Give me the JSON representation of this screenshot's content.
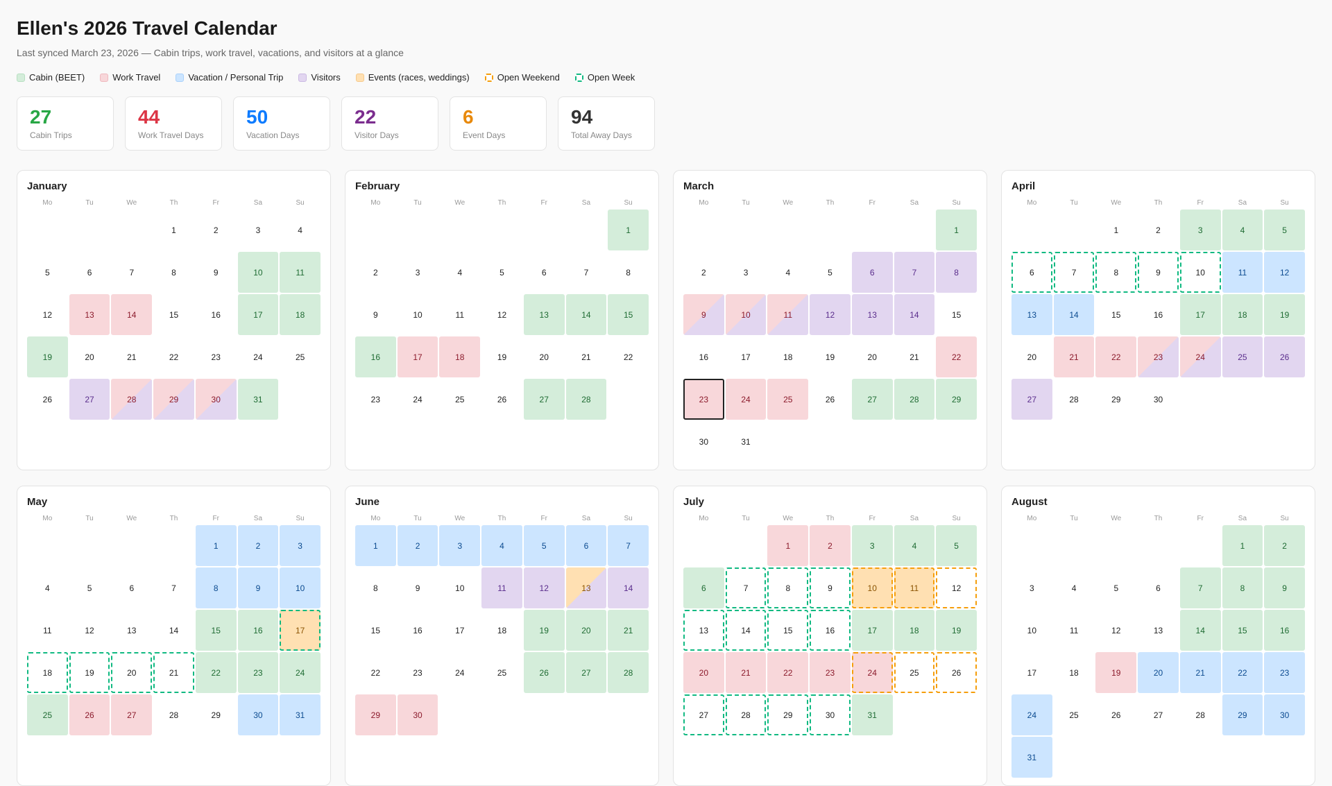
{
  "header": {
    "title": "Ellen's 2026 Travel Calendar",
    "subtitle": "Last synced March 23, 2026 — Cabin trips, work travel, vacations, and visitors at a glance"
  },
  "legend": [
    {
      "key": "cabin",
      "label": "Cabin (BEET)",
      "bg": "#d4edda",
      "border": "#b7dfc1"
    },
    {
      "key": "work",
      "label": "Work Travel",
      "bg": "#f8d7da",
      "border": "#efb8be"
    },
    {
      "key": "vacation",
      "label": "Vacation / Personal Trip",
      "bg": "#cce5ff",
      "border": "#a9d1fb"
    },
    {
      "key": "visitors",
      "label": "Visitors",
      "bg": "#e2d6f0",
      "border": "#cbb9e3"
    },
    {
      "key": "event",
      "label": "Events (races, weddings)",
      "bg": "#ffe0b2",
      "border": "#f6c98a"
    },
    {
      "key": "weekend",
      "label": "Open Weekend",
      "bg": "#ffffff",
      "border": "#f59e0b",
      "dashed": true
    },
    {
      "key": "week",
      "label": "Open Week",
      "bg": "#ffffff",
      "border": "#10b981",
      "dashed": true
    }
  ],
  "stats": [
    {
      "value": "27",
      "label": "Cabin Trips",
      "color": "#28a745"
    },
    {
      "value": "44",
      "label": "Work Travel Days",
      "color": "#dc3545"
    },
    {
      "value": "50",
      "label": "Vacation Days",
      "color": "#0d7bff"
    },
    {
      "value": "22",
      "label": "Visitor Days",
      "color": "#7b2d8e"
    },
    {
      "value": "6",
      "label": "Event Days",
      "color": "#e8890c"
    },
    {
      "value": "94",
      "label": "Total Away Days",
      "color": "#333333"
    }
  ],
  "weekdays": [
    "Mo",
    "Tu",
    "We",
    "Th",
    "Fr",
    "Sa",
    "Su"
  ],
  "months": [
    {
      "name": "January",
      "offset": 3,
      "days": 31,
      "marks": {
        "10": {
          "t": "cabin"
        },
        "11": {
          "t": "cabin"
        },
        "13": {
          "t": "work"
        },
        "14": {
          "t": "work"
        },
        "17": {
          "t": "cabin"
        },
        "18": {
          "t": "cabin"
        },
        "19": {
          "t": "cabin"
        },
        "27": {
          "t": "visitors"
        },
        "28": {
          "t": "work/visitors"
        },
        "29": {
          "t": "work/visitors"
        },
        "30": {
          "t": "work/visitors"
        },
        "31": {
          "t": "cabin"
        }
      }
    },
    {
      "name": "February",
      "offset": 6,
      "days": 28,
      "marks": {
        "1": {
          "t": "cabin"
        },
        "13": {
          "t": "cabin"
        },
        "14": {
          "t": "cabin"
        },
        "15": {
          "t": "cabin"
        },
        "16": {
          "t": "cabin"
        },
        "17": {
          "t": "work"
        },
        "18": {
          "t": "work"
        },
        "27": {
          "t": "cabin"
        },
        "28": {
          "t": "cabin"
        }
      }
    },
    {
      "name": "March",
      "offset": 6,
      "days": 31,
      "marks": {
        "1": {
          "t": "cabin"
        },
        "6": {
          "t": "visitors"
        },
        "7": {
          "t": "visitors"
        },
        "8": {
          "t": "visitors"
        },
        "9": {
          "t": "work/visitors"
        },
        "10": {
          "t": "work/visitors"
        },
        "11": {
          "t": "work/visitors"
        },
        "12": {
          "t": "visitors"
        },
        "13": {
          "t": "visitors"
        },
        "14": {
          "t": "visitors"
        },
        "22": {
          "t": "work"
        },
        "23": {
          "t": "work",
          "b": "today"
        },
        "24": {
          "t": "work"
        },
        "25": {
          "t": "work"
        },
        "27": {
          "t": "cabin"
        },
        "28": {
          "t": "cabin"
        },
        "29": {
          "t": "cabin"
        }
      }
    },
    {
      "name": "April",
      "offset": 2,
      "days": 30,
      "marks": {
        "3": {
          "t": "cabin"
        },
        "4": {
          "t": "cabin"
        },
        "5": {
          "t": "cabin"
        },
        "6": {
          "b": "week"
        },
        "7": {
          "b": "week"
        },
        "8": {
          "b": "week"
        },
        "9": {
          "b": "week"
        },
        "10": {
          "b": "week"
        },
        "11": {
          "t": "vacation"
        },
        "12": {
          "t": "vacation"
        },
        "13": {
          "t": "vacation"
        },
        "14": {
          "t": "vacation"
        },
        "17": {
          "t": "cabin"
        },
        "18": {
          "t": "cabin"
        },
        "19": {
          "t": "cabin"
        },
        "21": {
          "t": "work"
        },
        "22": {
          "t": "work"
        },
        "23": {
          "t": "work/visitors"
        },
        "24": {
          "t": "work/visitors"
        },
        "25": {
          "t": "visitors"
        },
        "26": {
          "t": "visitors"
        },
        "27": {
          "t": "visitors"
        }
      }
    },
    {
      "name": "May",
      "offset": 4,
      "days": 31,
      "marks": {
        "1": {
          "t": "vacation"
        },
        "2": {
          "t": "vacation"
        },
        "3": {
          "t": "vacation"
        },
        "8": {
          "t": "vacation"
        },
        "9": {
          "t": "vacation"
        },
        "10": {
          "t": "vacation"
        },
        "15": {
          "t": "cabin"
        },
        "16": {
          "t": "cabin"
        },
        "17": {
          "t": "event",
          "b": "week"
        },
        "18": {
          "b": "week"
        },
        "19": {
          "b": "week"
        },
        "20": {
          "b": "week"
        },
        "21": {
          "b": "week"
        },
        "22": {
          "t": "cabin"
        },
        "23": {
          "t": "cabin"
        },
        "24": {
          "t": "cabin"
        },
        "25": {
          "t": "cabin"
        },
        "26": {
          "t": "work"
        },
        "27": {
          "t": "work"
        },
        "30": {
          "t": "vacation"
        },
        "31": {
          "t": "vacation"
        }
      }
    },
    {
      "name": "June",
      "offset": 0,
      "days": 30,
      "marks": {
        "1": {
          "t": "vacation"
        },
        "2": {
          "t": "vacation"
        },
        "3": {
          "t": "vacation"
        },
        "4": {
          "t": "vacation"
        },
        "5": {
          "t": "vacation"
        },
        "6": {
          "t": "vacation"
        },
        "7": {
          "t": "vacation"
        },
        "11": {
          "t": "visitors"
        },
        "12": {
          "t": "visitors"
        },
        "13": {
          "t": "event/visitors"
        },
        "14": {
          "t": "visitors"
        },
        "19": {
          "t": "cabin"
        },
        "20": {
          "t": "cabin"
        },
        "21": {
          "t": "cabin"
        },
        "26": {
          "t": "cabin"
        },
        "27": {
          "t": "cabin"
        },
        "28": {
          "t": "cabin"
        },
        "29": {
          "t": "work"
        },
        "30": {
          "t": "work"
        }
      }
    },
    {
      "name": "July",
      "offset": 2,
      "days": 31,
      "marks": {
        "1": {
          "t": "work"
        },
        "2": {
          "t": "work"
        },
        "3": {
          "t": "cabin"
        },
        "4": {
          "t": "cabin"
        },
        "5": {
          "t": "cabin"
        },
        "6": {
          "t": "cabin"
        },
        "7": {
          "b": "week"
        },
        "8": {
          "b": "week"
        },
        "9": {
          "b": "week"
        },
        "10": {
          "t": "event",
          "b": "weekend"
        },
        "11": {
          "t": "event",
          "b": "weekend"
        },
        "12": {
          "b": "weekend"
        },
        "13": {
          "b": "week"
        },
        "14": {
          "b": "week"
        },
        "15": {
          "b": "week"
        },
        "16": {
          "b": "week"
        },
        "17": {
          "t": "cabin"
        },
        "18": {
          "t": "cabin"
        },
        "19": {
          "t": "cabin"
        },
        "20": {
          "t": "work"
        },
        "21": {
          "t": "work"
        },
        "22": {
          "t": "work"
        },
        "23": {
          "t": "work"
        },
        "24": {
          "t": "work",
          "b": "weekend"
        },
        "25": {
          "b": "weekend"
        },
        "26": {
          "b": "weekend"
        },
        "27": {
          "b": "week"
        },
        "28": {
          "b": "week"
        },
        "29": {
          "b": "week"
        },
        "30": {
          "b": "week"
        },
        "31": {
          "t": "cabin"
        }
      }
    },
    {
      "name": "August",
      "offset": 5,
      "days": 31,
      "marks": {
        "1": {
          "t": "cabin"
        },
        "2": {
          "t": "cabin"
        },
        "7": {
          "t": "cabin"
        },
        "8": {
          "t": "cabin"
        },
        "9": {
          "t": "cabin"
        },
        "14": {
          "t": "cabin"
        },
        "15": {
          "t": "cabin"
        },
        "16": {
          "t": "cabin"
        },
        "19": {
          "t": "work"
        },
        "20": {
          "t": "vacation"
        },
        "21": {
          "t": "vacation"
        },
        "22": {
          "t": "vacation"
        },
        "23": {
          "t": "vacation"
        },
        "24": {
          "t": "vacation"
        },
        "29": {
          "t": "vacation"
        },
        "30": {
          "t": "vacation"
        },
        "31": {
          "t": "vacation"
        }
      }
    }
  ],
  "type_colors": {
    "cabin": "#d4edda",
    "work": "#f8d7da",
    "vacation": "#cce5ff",
    "visitors": "#e2d6f0",
    "event": "#ffe0b2"
  }
}
